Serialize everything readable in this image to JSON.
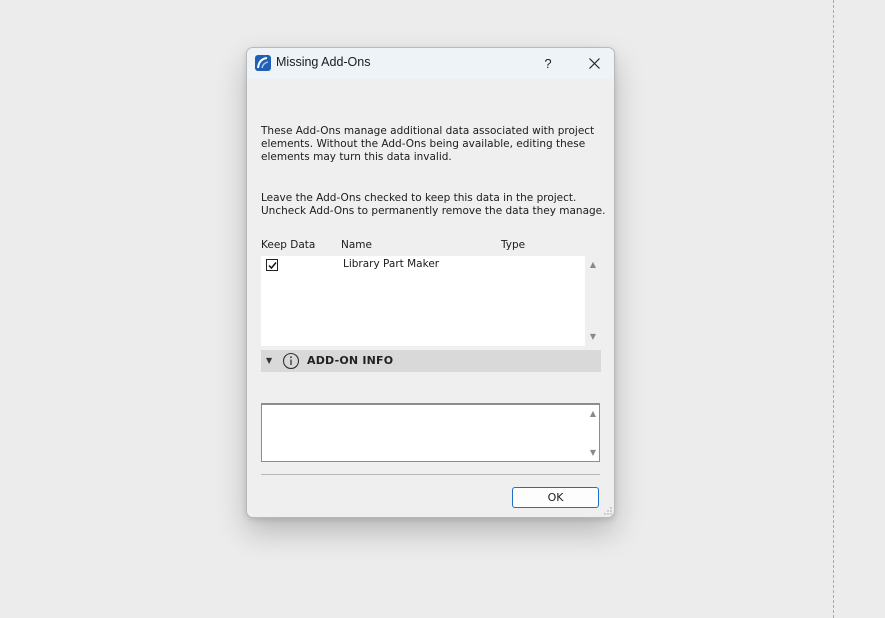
{
  "window": {
    "title": "Missing Add-Ons",
    "help_label": "?",
    "close_label": "✕",
    "icon": "archicad-app-icon"
  },
  "description": {
    "paragraph1": "These Add-Ons manage additional data associated with project\nelements. Without the Add-Ons being available, editing these\nelements may turn this data invalid.",
    "paragraph2": "Leave the Add-Ons checked to keep this data in the project.\nUncheck Add-Ons to permanently remove the data they manage."
  },
  "table": {
    "columns": [
      "Keep Data",
      "Name",
      "Type"
    ],
    "rows": [
      {
        "keep": true,
        "name": "Library Part Maker",
        "type": ""
      }
    ]
  },
  "info_section": {
    "title": "ADD-ON INFO",
    "expanded": true,
    "icon": "info-icon",
    "content": ""
  },
  "footer": {
    "ok_label": "OK"
  },
  "colors": {
    "accent": "#1e6fc8",
    "guide_line": "#e79a5c"
  }
}
